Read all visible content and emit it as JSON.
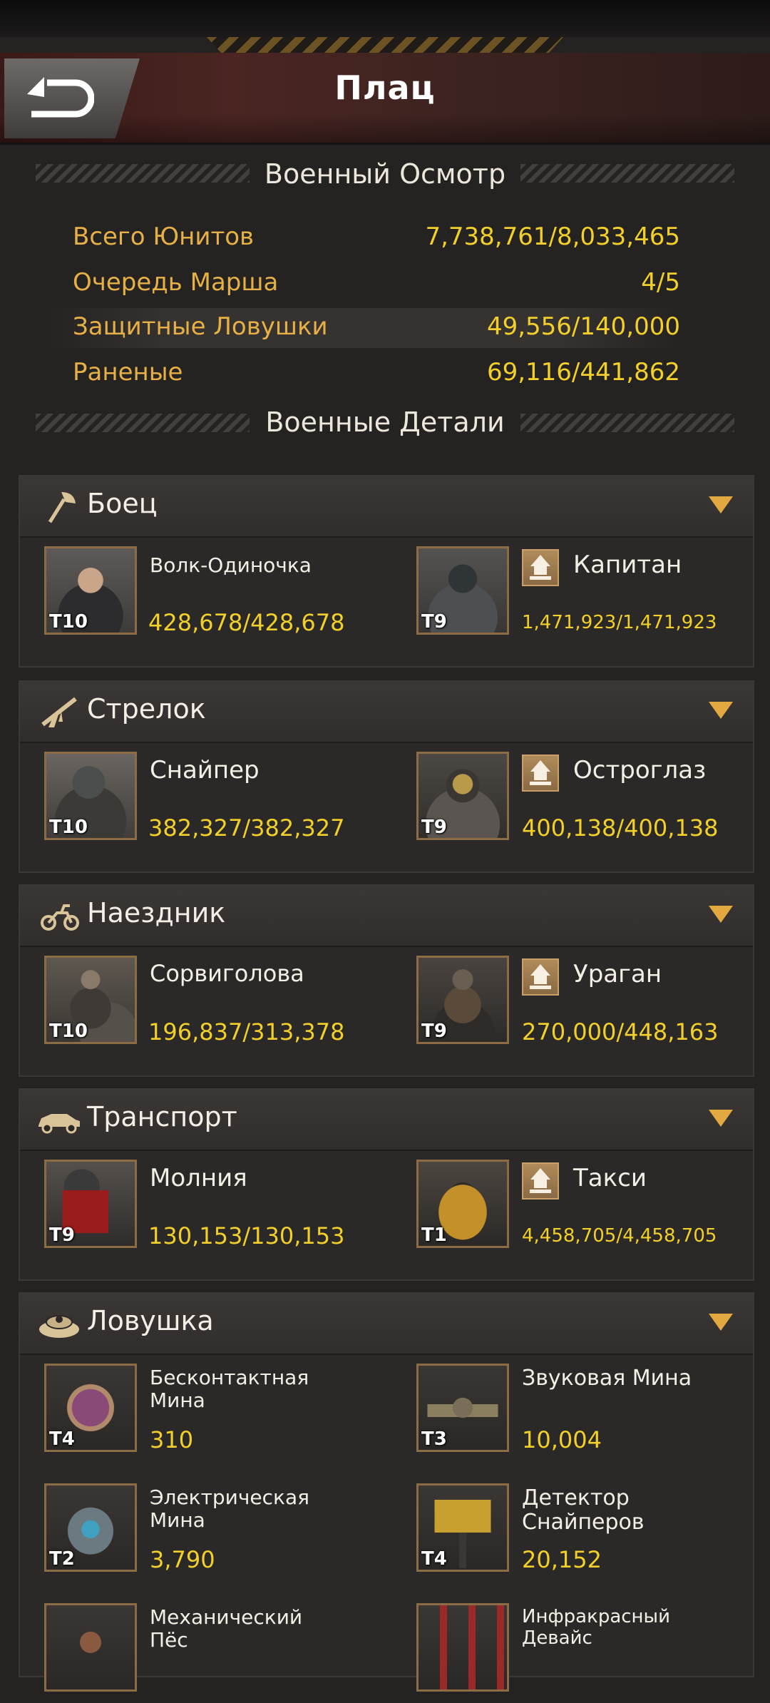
{
  "header": {
    "title": "Плац"
  },
  "overview": {
    "title": "Военный Осмотр",
    "stats": [
      {
        "label": "Всего Юнитов",
        "value": "7,738,761/8,033,465"
      },
      {
        "label": "Очередь Марша",
        "value": "4/5"
      },
      {
        "label": "Защитные Ловушки",
        "value": "49,556/140,000"
      },
      {
        "label": "Раненые",
        "value": "69,116/441,862"
      }
    ]
  },
  "details": {
    "title": "Военные Детали"
  },
  "categories": [
    {
      "name": "Боец",
      "icon": "axe-icon",
      "units": [
        {
          "name": "Волк-Одиночка",
          "tier": "T10",
          "count": "428,678/428,678",
          "upgrade": false
        },
        {
          "name": "Капитан",
          "tier": "T9",
          "count": "1,471,923/1,471,923",
          "upgrade": true
        }
      ]
    },
    {
      "name": "Стрелок",
      "icon": "rifle-icon",
      "units": [
        {
          "name": "Снайпер",
          "tier": "T10",
          "count": "382,327/382,327",
          "upgrade": false
        },
        {
          "name": "Остроглаз",
          "tier": "T9",
          "count": "400,138/400,138",
          "upgrade": true
        }
      ]
    },
    {
      "name": "Наездник",
      "icon": "motorcycle-icon",
      "units": [
        {
          "name": "Сорвиголова",
          "tier": "T10",
          "count": "196,837/313,378",
          "upgrade": false
        },
        {
          "name": "Ураган",
          "tier": "T9",
          "count": "270,000/448,163",
          "upgrade": true
        }
      ]
    },
    {
      "name": "Транспорт",
      "icon": "car-icon",
      "units": [
        {
          "name": "Молния",
          "tier": "T9",
          "count": "130,153/130,153",
          "upgrade": false
        },
        {
          "name": "Такси",
          "tier": "T1",
          "count": "4,458,705/4,458,705",
          "upgrade": true
        }
      ]
    },
    {
      "name": "Ловушка",
      "icon": "mine-icon",
      "units": [
        {
          "name": "Бесконтактная Мина",
          "tier": "T4",
          "count": "310"
        },
        {
          "name": "Звуковая Мина",
          "tier": "T3",
          "count": "10,004"
        },
        {
          "name": "Электрическая Мина",
          "tier": "T2",
          "count": "3,790"
        },
        {
          "name": "Детектор Снайперов",
          "tier": "T4",
          "count": "20,152"
        },
        {
          "name": "Механический Пёс",
          "tier": "",
          "count": ""
        },
        {
          "name": "Инфракрасный Девайс",
          "tier": "",
          "count": ""
        }
      ]
    }
  ],
  "colors": {
    "accent_gold": "#e6b046",
    "value_yellow": "#f2cf2a",
    "panel_bg": "#2b2928"
  }
}
